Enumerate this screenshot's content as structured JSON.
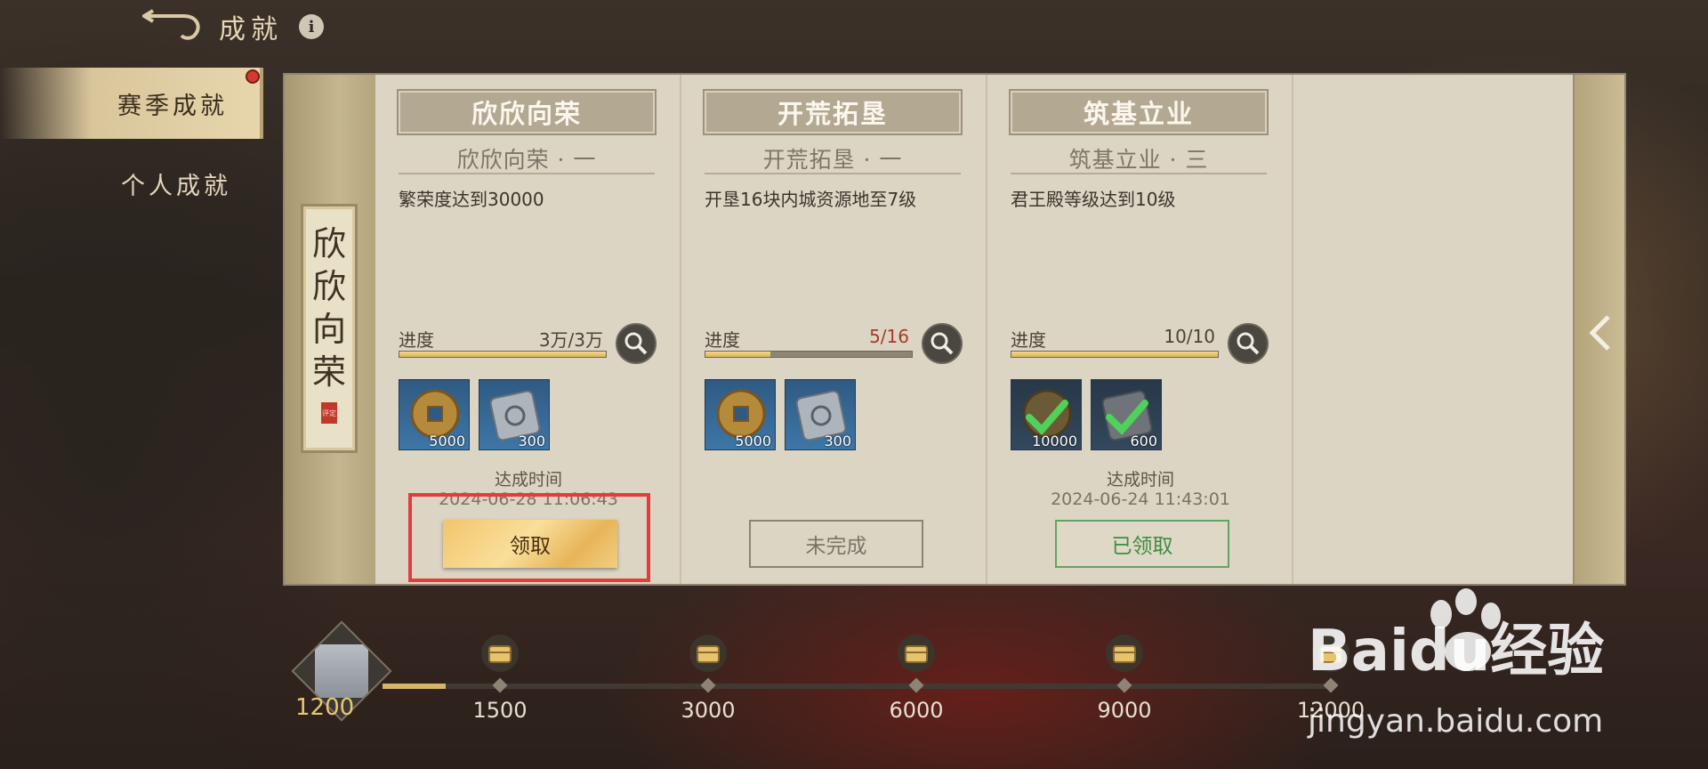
{
  "header": {
    "title": "成就",
    "info_label": "i"
  },
  "sidebar": {
    "items": [
      {
        "label": "赛季成就",
        "active": true
      },
      {
        "label": "个人成就",
        "active": false
      }
    ]
  },
  "banner": {
    "chars": [
      "欣",
      "欣",
      "向",
      "荣"
    ],
    "seal": "评定"
  },
  "cards": [
    {
      "title": "欣欣向荣",
      "subtitle": "欣欣向荣 · 一",
      "description": "繁荣度达到30000",
      "progress_label": "进度",
      "progress_text": "3万/3万",
      "progress_fraction": 1.0,
      "rewards": [
        {
          "icon": "copper-coin-icon",
          "count": "5000",
          "claimed": false
        },
        {
          "icon": "scroll-icon",
          "count": "300",
          "claimed": false
        }
      ],
      "time_label": "达成时间",
      "time_value": "2024-06-28 11:06:43",
      "button_label": "领取",
      "button_state": "claim"
    },
    {
      "title": "开荒拓垦",
      "subtitle": "开荒拓垦 · 一",
      "description": "开垦16块内城资源地至7级",
      "progress_label": "进度",
      "progress_text": "5/16",
      "progress_fraction": 0.3125,
      "rewards": [
        {
          "icon": "copper-coin-icon",
          "count": "5000",
          "claimed": false
        },
        {
          "icon": "scroll-icon",
          "count": "300",
          "claimed": false
        }
      ],
      "time_label": "",
      "time_value": "",
      "button_label": "未完成",
      "button_state": "incomplete"
    },
    {
      "title": "筑基立业",
      "subtitle": "筑基立业 · 三",
      "description": "君王殿等级达到10级",
      "progress_label": "进度",
      "progress_text": "10/10",
      "progress_fraction": 1.0,
      "rewards": [
        {
          "icon": "copper-coin-icon",
          "count": "10000",
          "claimed": true
        },
        {
          "icon": "scroll-icon",
          "count": "600",
          "claimed": true
        }
      ],
      "time_label": "达成时间",
      "time_value": "2024-06-24 11:43:01",
      "button_label": "已领取",
      "button_state": "claimed"
    }
  ],
  "milestones": {
    "current": "1200",
    "current_fraction": 0.066,
    "points": [
      "1500",
      "3000",
      "6000",
      "9000",
      "12000"
    ]
  },
  "watermark": {
    "logo": "Baidu经验",
    "url": "jingyan.baidu.com"
  },
  "colors": {
    "accent_gold": "#d6b565",
    "claim_button": "#f2c56c",
    "claimed_green": "#3f8b45",
    "warn_red": "#a83a2a",
    "highlight": "#e43b3b"
  }
}
